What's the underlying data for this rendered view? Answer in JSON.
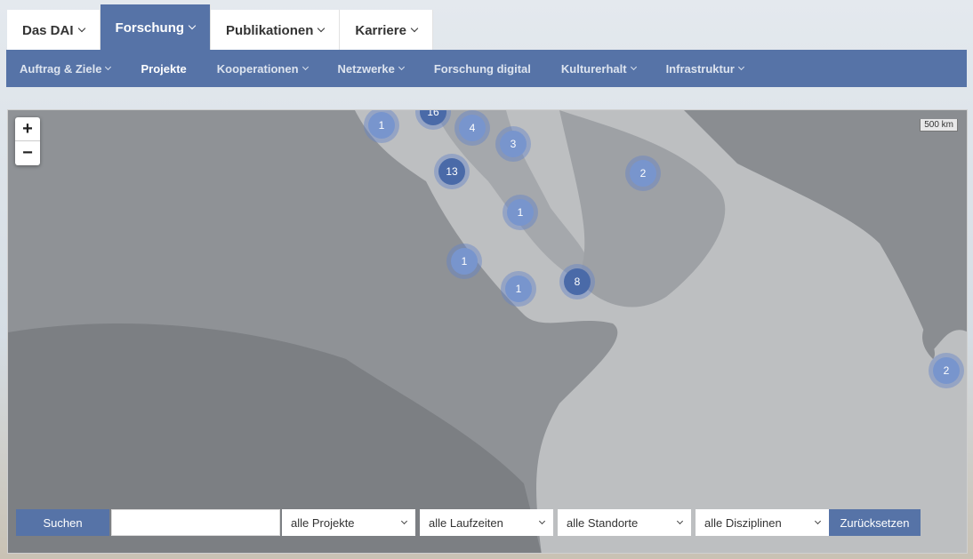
{
  "top_nav": [
    {
      "label": "Das DAI"
    },
    {
      "label": "Forschung"
    },
    {
      "label": "Publikationen"
    },
    {
      "label": "Karriere"
    }
  ],
  "sub_nav": [
    {
      "label": "Auftrag & Ziele"
    },
    {
      "label": "Projekte"
    },
    {
      "label": "Kooperationen"
    },
    {
      "label": "Netzwerke"
    },
    {
      "label": "Forschung digital"
    },
    {
      "label": "Kulturerhalt"
    },
    {
      "label": "Infrastruktur"
    }
  ],
  "map": {
    "zoom_in": "+",
    "zoom_out": "−",
    "scale": "500 km",
    "clusters": [
      "1",
      "16",
      "4",
      "3",
      "13",
      "2",
      "1",
      "1",
      "1",
      "8",
      "2"
    ]
  },
  "filters": {
    "search_button": "Suchen",
    "search_value": "",
    "projects": "alle Projekte",
    "periods": "alle Laufzeiten",
    "locations": "alle Standorte",
    "disciplines": "alle Disziplinen",
    "reset_button": "Zurücksetzen"
  }
}
